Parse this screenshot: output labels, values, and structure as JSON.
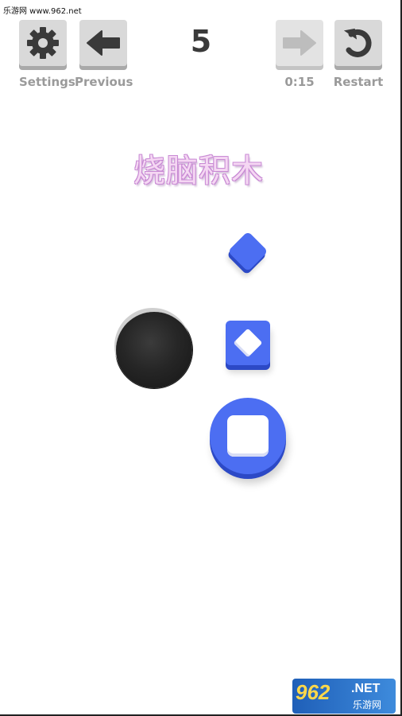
{
  "watermark": "乐游网 www.962.net",
  "toolbar": {
    "settings_label": "Settings",
    "previous_label": "Previous",
    "level": "5",
    "timer": "0:15",
    "restart_label": "Restart"
  },
  "title": "烧脑积木",
  "logo": {
    "number": "962",
    "net": ".NET",
    "cn": "乐游网"
  },
  "colors": {
    "piece_blue": "#4c6ef2",
    "button_gray": "#d9d9d9",
    "label_gray": "#9a9a9a",
    "hole_dark": "#1e1e1e"
  },
  "icons": {
    "settings": "gear-icon",
    "previous": "arrow-left-icon",
    "next": "arrow-right-icon",
    "restart": "restart-icon"
  }
}
